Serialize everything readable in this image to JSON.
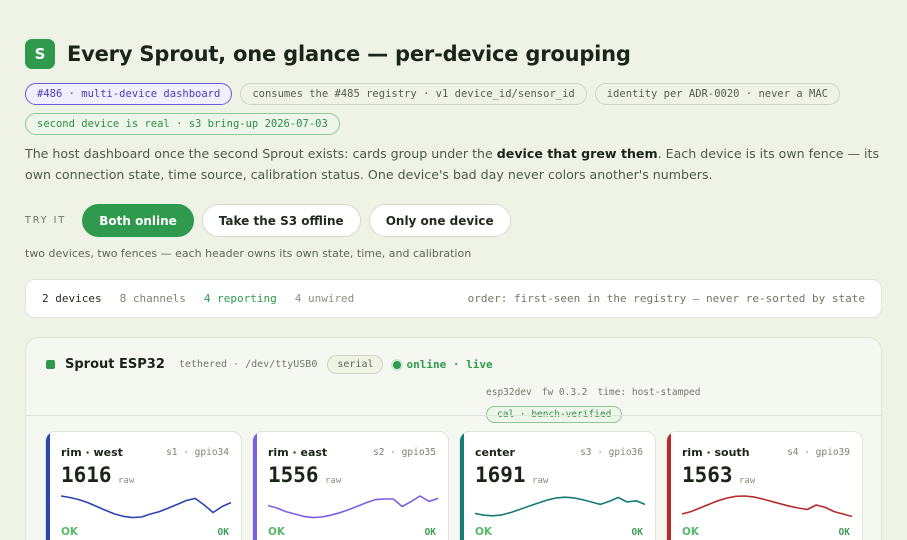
{
  "header": {
    "logo_letter": "S",
    "title": "Every Sprout, one glance — per-device grouping"
  },
  "tags": [
    {
      "text": "#486 · multi-device dashboard",
      "style": "purple"
    },
    {
      "text": "consumes the #485 registry · v1 device_id/sensor_id",
      "style": "plain"
    },
    {
      "text": "identity per ADR-0020 · never a MAC",
      "style": "plain"
    },
    {
      "text": "second device is real · s3 bring-up 2026-07-03",
      "style": "green"
    }
  ],
  "description": {
    "before": "The host dashboard once the second Sprout exists: cards group under the ",
    "bold": "device that grew them",
    "after": ". Each device is its own fence — its own connection state, time source, calibration status. One device's bad day never colors another's numbers."
  },
  "try_it": {
    "label": "TRY IT",
    "buttons": [
      "Both online",
      "Take the S3 offline",
      "Only one device"
    ],
    "active": 0,
    "note": "two devices, two fences — each header owns its own state, time, and calibration"
  },
  "status_bar": {
    "devices": "2 devices",
    "channels": "8 channels",
    "reporting": "4 reporting",
    "unwired": "4 unwired",
    "order": "order: first-seen in the registry — never re-sorted by state"
  },
  "device": {
    "name": "Sprout ESP32",
    "path": "tethered · /dev/ttyUSB0",
    "connection": "serial",
    "status": "online · live",
    "meta": [
      "esp32dev",
      "fw 0.3.2",
      "time: host-stamped"
    ],
    "calibration": "cal · bench-verified",
    "colors": {
      "accent": "#2f9a4d"
    },
    "cards": [
      {
        "name": "rim · west",
        "pin": "s1 · gpio34",
        "value": "1616",
        "unit": "raw",
        "status_left": "OK",
        "status_right": "OK",
        "color": "#2a44b0",
        "trend": [
          0.9,
          0.85,
          0.78,
          0.68,
          0.55,
          0.42,
          0.3,
          0.22,
          0.18,
          0.2,
          0.3,
          0.38,
          0.5,
          0.62,
          0.75,
          0.82,
          0.6,
          0.35,
          0.55,
          0.68
        ]
      },
      {
        "name": "rim · east",
        "pin": "s2 · gpio35",
        "value": "1556",
        "unit": "raw",
        "status_left": "OK",
        "status_right": "OK",
        "color": "#7b5ee8",
        "trend": [
          0.58,
          0.5,
          0.38,
          0.3,
          0.22,
          0.18,
          0.2,
          0.26,
          0.34,
          0.44,
          0.56,
          0.68,
          0.78,
          0.8,
          0.8,
          0.55,
          0.72,
          0.9,
          0.72,
          0.82
        ]
      },
      {
        "name": "center",
        "pin": "s3 · gpio36",
        "value": "1691",
        "unit": "raw",
        "status_left": "OK",
        "status_right": "OK",
        "color": "#157a78",
        "trend": [
          0.32,
          0.26,
          0.24,
          0.27,
          0.35,
          0.45,
          0.56,
          0.66,
          0.76,
          0.83,
          0.86,
          0.84,
          0.78,
          0.7,
          0.62,
          0.72,
          0.85,
          0.7,
          0.74,
          0.62
        ]
      },
      {
        "name": "rim · south",
        "pin": "s4 · gpio39",
        "value": "1563",
        "unit": "raw",
        "status_left": "OK",
        "status_right": "OK",
        "color": "#b52a2a",
        "trend": [
          0.3,
          0.38,
          0.5,
          0.62,
          0.74,
          0.83,
          0.89,
          0.9,
          0.87,
          0.8,
          0.72,
          0.64,
          0.56,
          0.5,
          0.45,
          0.6,
          0.52,
          0.38,
          0.3,
          0.22
        ]
      }
    ]
  }
}
